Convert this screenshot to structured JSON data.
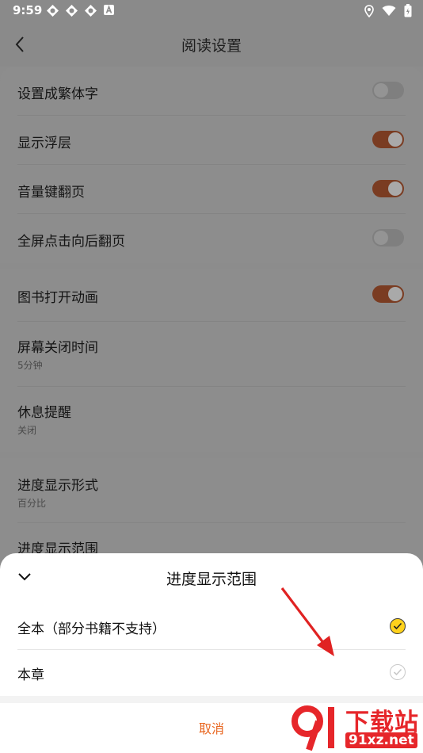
{
  "status_bar": {
    "time": "9:59"
  },
  "header": {
    "title": "阅读设置"
  },
  "settings": {
    "group1": [
      {
        "label": "设置成繁体字",
        "on": false
      },
      {
        "label": "显示浮层",
        "on": true
      },
      {
        "label": "音量键翻页",
        "on": true
      },
      {
        "label": "全屏点击向后翻页",
        "on": false
      }
    ],
    "book_open_animation": {
      "label": "图书打开动画",
      "on": true
    },
    "screen_off_time": {
      "label": "屏幕关闭时间",
      "value": "5分钟"
    },
    "rest_reminder": {
      "label": "休息提醒",
      "value": "关闭"
    },
    "progress_format": {
      "label": "进度显示形式",
      "value": "百分比"
    },
    "progress_range": {
      "label": "进度显示范围"
    }
  },
  "sheet": {
    "title": "进度显示范围",
    "options": [
      {
        "label": "全本（部分书籍不支持）",
        "selected": true
      },
      {
        "label": "本章",
        "selected": false
      }
    ],
    "cancel_label": "取消"
  },
  "colors": {
    "accent": "#e8641d",
    "check_selected": "#ffd21c",
    "toggle_on": "#e8641d"
  },
  "watermark": {
    "text": "下载站",
    "url": "91xz.net"
  }
}
